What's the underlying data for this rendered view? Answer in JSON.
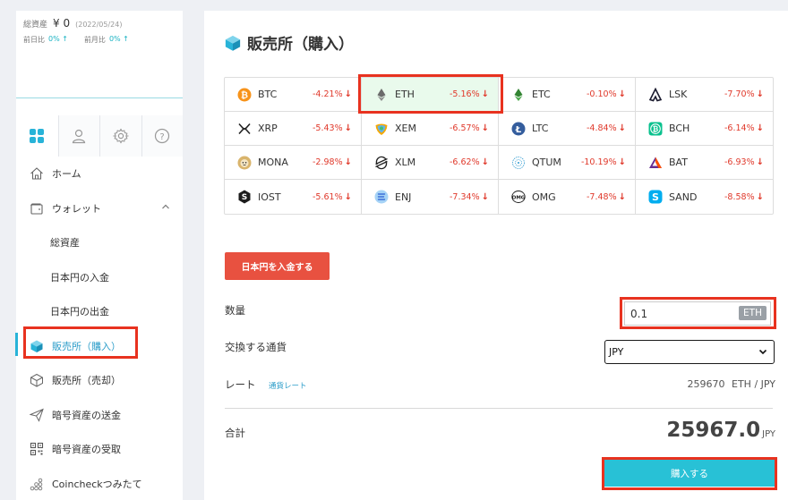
{
  "assets": {
    "total_label": "総資産",
    "total_value": "¥ 0",
    "date": "(2022/05/24)",
    "daily_label": "前日比",
    "daily_value": "0% ↑",
    "monthly_label": "前月比",
    "monthly_value": "0% ↑"
  },
  "sidebar_tabs": [
    "dashboard-icon",
    "user-icon",
    "gear-icon",
    "help-icon"
  ],
  "nav": {
    "home": "ホーム",
    "wallet": "ウォレット",
    "total_assets": "総資産",
    "jpy_deposit": "日本円の入金",
    "jpy_withdraw": "日本円の出金",
    "exchange_buy": "販売所（購入）",
    "exchange_sell": "販売所（売却）",
    "crypto_send": "暗号資産の送金",
    "crypto_receive": "暗号資産の受取",
    "coincheck_tsumitate": "Coincheckつみたて"
  },
  "page": {
    "title": "販売所（購入）"
  },
  "coins": [
    {
      "symbol": "BTC",
      "change": "-4.21%",
      "icon": "bitcoin-icon",
      "color": "#f7931a"
    },
    {
      "symbol": "ETH",
      "change": "-5.16%",
      "icon": "ethereum-icon",
      "color": "#627eea",
      "selected": true
    },
    {
      "symbol": "ETC",
      "change": "-0.10%",
      "icon": "ethereum-classic-icon",
      "color": "#328332"
    },
    {
      "symbol": "LSK",
      "change": "-7.70%",
      "icon": "lisk-icon",
      "color": "#1a1a2e"
    },
    {
      "symbol": "XRP",
      "change": "-5.43%",
      "icon": "xrp-icon",
      "color": "#222222"
    },
    {
      "symbol": "XEM",
      "change": "-6.57%",
      "icon": "nem-icon",
      "color": "#67b2e8"
    },
    {
      "symbol": "LTC",
      "change": "-4.84%",
      "icon": "litecoin-icon",
      "color": "#345d9d"
    },
    {
      "symbol": "BCH",
      "change": "-6.14%",
      "icon": "bitcoin-cash-icon",
      "color": "#0ac18e"
    },
    {
      "symbol": "MONA",
      "change": "-2.98%",
      "icon": "monacoin-icon",
      "color": "#d9b46c"
    },
    {
      "symbol": "XLM",
      "change": "-6.62%",
      "icon": "stellar-icon",
      "color": "#222222"
    },
    {
      "symbol": "QTUM",
      "change": "-10.19%",
      "icon": "qtum-icon",
      "color": "#2e9ad0"
    },
    {
      "symbol": "BAT",
      "change": "-6.93%",
      "icon": "bat-icon",
      "color": "#ff5000"
    },
    {
      "symbol": "IOST",
      "change": "-5.61%",
      "icon": "iost-icon",
      "color": "#1c1c1c"
    },
    {
      "symbol": "ENJ",
      "change": "-7.34%",
      "icon": "enjin-icon",
      "color": "#7866d5"
    },
    {
      "symbol": "OMG",
      "change": "-7.48%",
      "icon": "omg-icon",
      "color": "#1a1a1a"
    },
    {
      "symbol": "SAND",
      "change": "-8.58%",
      "icon": "sandbox-icon",
      "color": "#00adef"
    }
  ],
  "form": {
    "deposit_button": "日本円を入金する",
    "quantity_label": "数量",
    "quantity_value": "0.1",
    "quantity_unit": "ETH",
    "currency_label": "交換する通貨",
    "currency_selected": "JPY",
    "rate_label": "レート",
    "rate_link": "通貨レート",
    "rate_value": "259670",
    "rate_unit": "ETH / JPY",
    "total_label": "合計",
    "total_value": "25967.0",
    "total_unit": "JPY",
    "buy_button": "購入する"
  },
  "colors": {
    "accent": "#28c1d6",
    "negative": "#e0392b",
    "deposit": "#e85140",
    "highlight": "#e8321f"
  }
}
